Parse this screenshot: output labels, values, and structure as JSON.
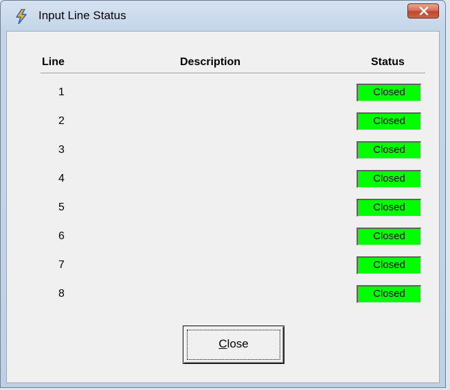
{
  "window": {
    "title": "Input Line Status",
    "app_icon": "lightning-bolt-icon",
    "close_icon": "close-x-icon"
  },
  "table": {
    "headers": {
      "line": "Line",
      "description": "Description",
      "status": "Status"
    },
    "rows": [
      {
        "line": "1",
        "description": "",
        "status": "Closed"
      },
      {
        "line": "2",
        "description": "",
        "status": "Closed"
      },
      {
        "line": "3",
        "description": "",
        "status": "Closed"
      },
      {
        "line": "4",
        "description": "",
        "status": "Closed"
      },
      {
        "line": "5",
        "description": "",
        "status": "Closed"
      },
      {
        "line": "6",
        "description": "",
        "status": "Closed"
      },
      {
        "line": "7",
        "description": "",
        "status": "Closed"
      },
      {
        "line": "8",
        "description": "",
        "status": "Closed"
      }
    ],
    "status_color": "#00ff00"
  },
  "buttons": {
    "close_accel": "C",
    "close_rest": "lose"
  }
}
